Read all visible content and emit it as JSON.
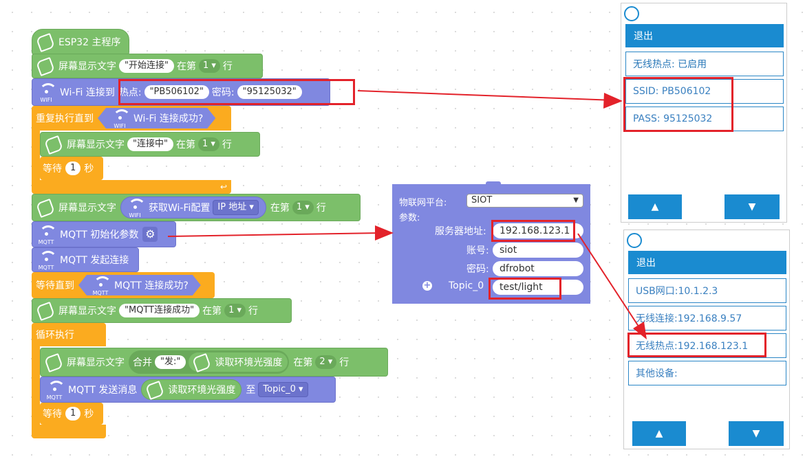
{
  "program": {
    "hat_label": "ESP32 主程序",
    "show1": {
      "label": "屏幕显示文字",
      "text": "\"开始连接\"",
      "row_prefix": "在第",
      "row": "1",
      "row_suffix": "行"
    },
    "wifi_connect": {
      "label": "Wi-Fi 连接到",
      "hotspot_label": "热点:",
      "ssid": "\"PB506102\"",
      "pwd_label": "密码:",
      "pwd": "\"95125032\""
    },
    "repeat_until": {
      "label": "重复执行直到",
      "cond": "Wi-Fi 连接成功?"
    },
    "show2": {
      "label": "屏幕显示文字",
      "text": "\"连接中\"",
      "row_prefix": "在第",
      "row": "1",
      "row_suffix": "行"
    },
    "wait1": {
      "label": "等待",
      "value": "1",
      "unit": "秒"
    },
    "show3": {
      "label": "屏幕显示文字",
      "get_label": "获取Wi-Fi配置",
      "dropdown": "IP 地址",
      "row_prefix": "在第",
      "row": "1",
      "row_suffix": "行"
    },
    "mqtt_init": {
      "label": "MQTT 初始化参数"
    },
    "mqtt_connect": {
      "label": "MQTT 发起连接"
    },
    "wait_until": {
      "label": "等待直到",
      "cond": "MQTT 连接成功?"
    },
    "show4": {
      "label": "屏幕显示文字",
      "text": "\"MQTT连接成功\"",
      "row_prefix": "在第",
      "row": "1",
      "row_suffix": "行"
    },
    "loop": {
      "label": "循环执行"
    },
    "show5": {
      "label": "屏幕显示文字",
      "join": "合并",
      "prefix": "\"发:\"",
      "sensor": "读取环境光强度",
      "row_prefix": "在第",
      "row": "2",
      "row_suffix": "行"
    },
    "mqtt_send": {
      "label": "MQTT 发送消息",
      "sensor": "读取环境光强度",
      "to": "至",
      "topic": "Topic_0"
    },
    "wait2": {
      "label": "等待",
      "value": "1",
      "unit": "秒"
    },
    "wifi_tag": "WIFI",
    "mqtt_tag": "MQTT"
  },
  "mqtt_popup": {
    "platform_label": "物联网平台:",
    "platform_value": "SIOT",
    "params_label": "参数:",
    "server_label": "服务器地址:",
    "server": "192.168.123.1",
    "account_label": "账号:",
    "account": "siot",
    "password_label": "密码:",
    "password": "dfrobot",
    "topic_label": "Topic_0",
    "topic": "test/light"
  },
  "panel1": {
    "exit": "退出",
    "items": [
      "无线热点: 已启用",
      "SSID: PB506102",
      "PASS: 95125032"
    ],
    "up": "▲",
    "down": "▼"
  },
  "panel2": {
    "exit": "退出",
    "items": [
      "USB网口:10.1.2.3",
      "无线连接:192.168.9.57",
      "无线热点:192.168.123.1",
      "其他设备:"
    ],
    "up": "▲",
    "down": "▼"
  },
  "colors": {
    "event": "#7cbf6a",
    "network": "#8088e0",
    "control": "#fbab1f",
    "highlight": "#e3222a",
    "panel_accent": "#1a8bd0"
  }
}
